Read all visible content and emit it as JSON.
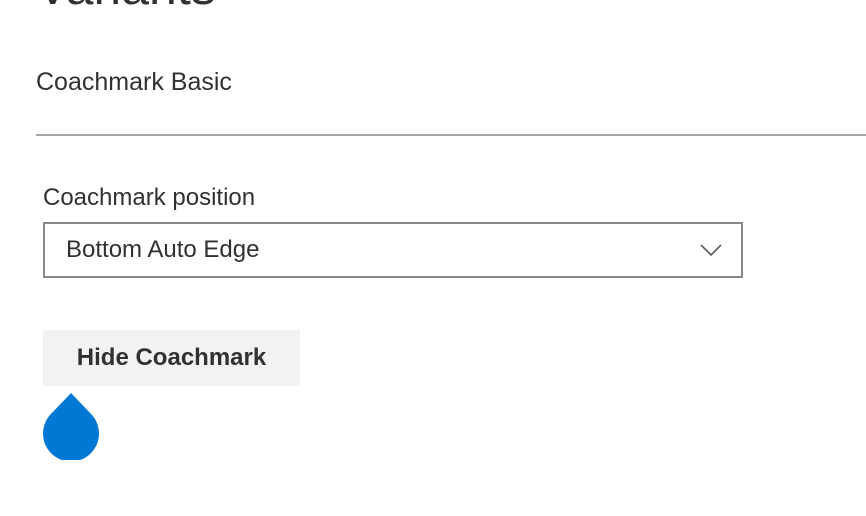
{
  "section": {
    "title": "Variants"
  },
  "example": {
    "title": "Coachmark Basic"
  },
  "position_field": {
    "label": "Coachmark position",
    "selected_value": "Bottom Auto Edge",
    "chevron_icon": "chevron-down-icon"
  },
  "toggle_button": {
    "label": "Hide Coachmark"
  },
  "coachmark": {
    "icon": "coachmark-beacon-icon",
    "color": "#0078d4"
  }
}
